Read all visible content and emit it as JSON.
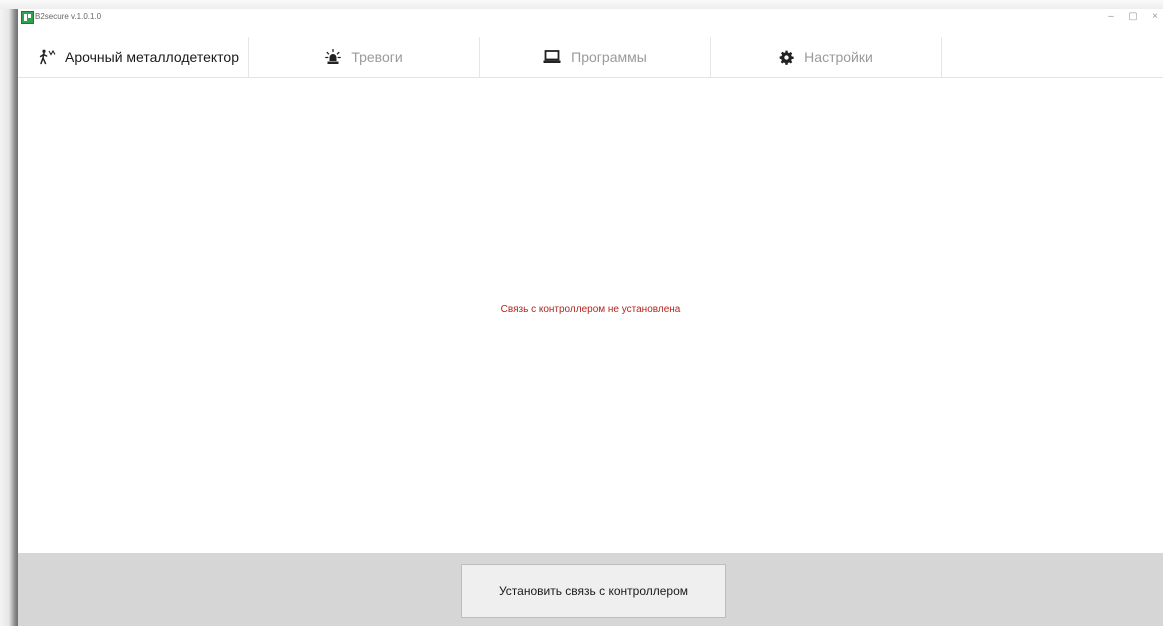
{
  "window": {
    "title": "B2secure v.1.0.1.0",
    "controls": {
      "minimize": "–",
      "restore": "▢",
      "close": "×"
    }
  },
  "tabs": [
    {
      "label": "Арочный металлодетектор",
      "icon": "walkthrough-detector-icon",
      "active": true
    },
    {
      "label": "Тревоги",
      "icon": "alarm-beacon-icon",
      "active": false
    },
    {
      "label": "Программы",
      "icon": "laptop-icon",
      "active": false
    },
    {
      "label": "Настройки",
      "icon": "gear-icon",
      "active": false
    }
  ],
  "main": {
    "status_message": "Связь с контроллером не установлена",
    "status_color": "#b3261e"
  },
  "footer": {
    "connect_button_label": "Установить связь с контроллером"
  },
  "colors": {
    "footer_bg": "#d6d6d6",
    "tab_text_inactive": "#9a9a9a",
    "tab_text_active": "#1a1a1a"
  }
}
